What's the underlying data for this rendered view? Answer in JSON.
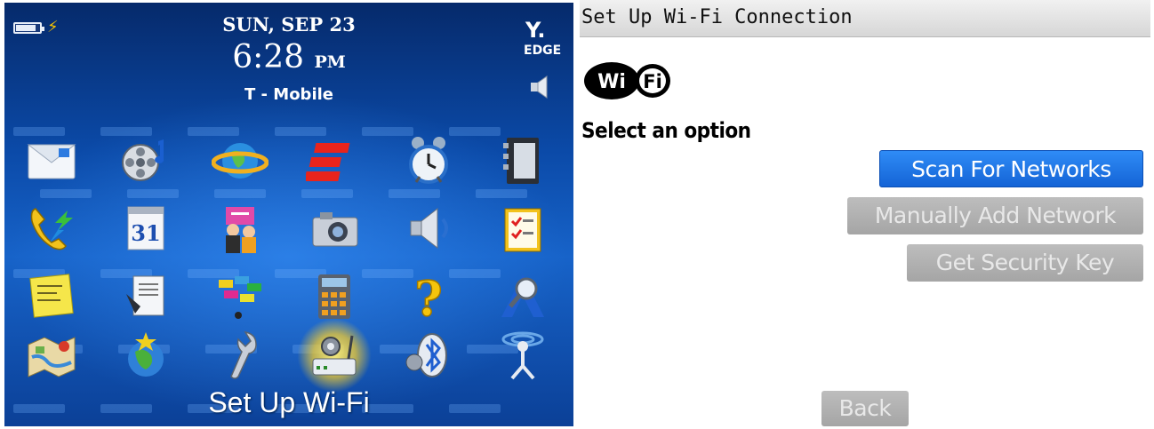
{
  "home": {
    "date": "SUN, SEP 23",
    "time": "6:28",
    "ampm": "PM",
    "carrier": "T - Mobile",
    "network_type": "EDGE",
    "selected_app_caption": "Set Up Wi-Fi",
    "apps": [
      {
        "name": "messages-icon"
      },
      {
        "name": "media-icon"
      },
      {
        "name": "browser-icon"
      },
      {
        "name": "espn-icon"
      },
      {
        "name": "clock-icon"
      },
      {
        "name": "contacts-icon"
      },
      {
        "name": "call-log-icon"
      },
      {
        "name": "calendar-icon"
      },
      {
        "name": "instant-messenger-icon"
      },
      {
        "name": "camera-icon"
      },
      {
        "name": "sounds-icon"
      },
      {
        "name": "tasks-icon"
      },
      {
        "name": "memopad-icon"
      },
      {
        "name": "documents-icon"
      },
      {
        "name": "brickbreaker-icon"
      },
      {
        "name": "calculator-icon"
      },
      {
        "name": "help-icon"
      },
      {
        "name": "search-icon"
      },
      {
        "name": "maps-icon"
      },
      {
        "name": "globe-icon"
      },
      {
        "name": "options-icon"
      },
      {
        "name": "setup-wifi-icon"
      },
      {
        "name": "bluetooth-icon"
      },
      {
        "name": "manage-connections-icon"
      }
    ],
    "calendar_day": "31",
    "colors": {
      "background": "#0b4aa8",
      "highlight": "#ffd21f"
    }
  },
  "setup": {
    "title": "Set Up Wi-Fi Connection",
    "logo_text_left": "Wi",
    "logo_text_right": "Fi",
    "prompt": "Select an option",
    "buttons": {
      "scan": "Scan For Networks",
      "manual": "Manually Add Network",
      "security": "Get Security Key",
      "back": "Back"
    },
    "colors": {
      "active_button": "#1e78e8",
      "disabled_button": "#b0b0b0"
    }
  }
}
